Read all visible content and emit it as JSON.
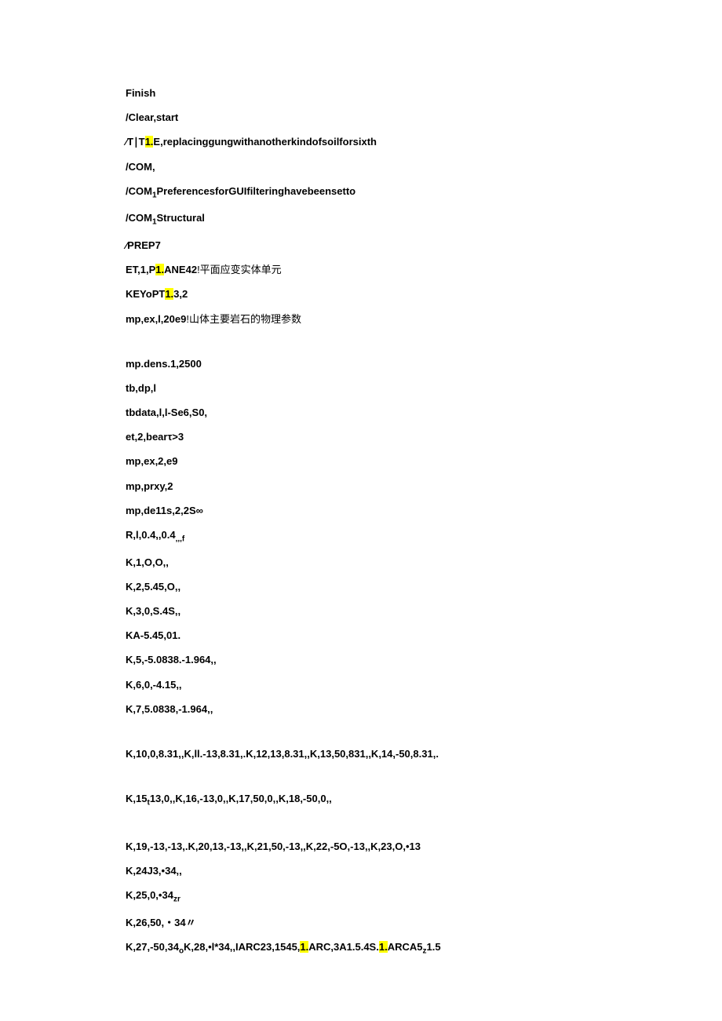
{
  "lines": {
    "l1": "Finish",
    "l2": "/Clear,start",
    "l3a": "∕T∣T",
    "l3b": "1.",
    "l3c": "E,replacinggungwithanotherkindofsoilforsixth",
    "l4": "/COM,",
    "l5a": "/COM",
    "l5b": "1",
    "l5c": "PreferencesforGUIfilteringhavebeensetto",
    "l6a": "/COM",
    "l6b": "1",
    "l6c": "Structural",
    "l7": "∕PREP7",
    "l8a": "ET,1,P",
    "l8b": "1.",
    "l8c": "ANE42",
    "l8d": "!平面应变实体单元",
    "l9a": "KEYoPT",
    "l9b": "1.",
    "l9c": "3,2",
    "l10a": "mp,ex,l,20e9",
    "l10b": "!山体主要岩石的物理参数",
    "l11": "mp.dens.1,2500",
    "l12": "tb,dp,l",
    "l13": "tbdata,l,l-Se6,S0,",
    "l14": "et,2,bearτ>3",
    "l15": "mp,ex,2,e9",
    "l16": "mp,prxy,2",
    "l17": "mp,de11s,2,2S∞",
    "l18a": "R,l,0.4,,0.4",
    "l18b": ",,,f",
    "l19": "K,1,O,O,,",
    "l20": "K,2,5.45,O,,",
    "l21": "K,3,0,S.4S,,",
    "l22": "KA-5.45,01.",
    "l23": "K,5,-5.0838.-1.964,,",
    "l24": "K,6,0,-4.15,,",
    "l25": "K,7,5.0838,-1.964,,",
    "l26": "K,10,0,8.31,,K,ll.-13,8.31,.K,12,13,8.31,,K,13,50,831,,K,14,-50,8.31,.",
    "l27a": "K,15",
    "l27b": "t",
    "l27c": "13,0,,K,16,-13,0,,K,17,50,0,,K,18,-50,0,,",
    "l28": "K,19,-13,-13,.K,20,13,-13,,K,21,50,-13,,K,22,-5O,-13,,K,23,O,•13",
    "l29": "K,24J3,•34,,",
    "l30a": "K,25,0,•34",
    "l30b": "zr",
    "l31": "K,26,50,・34〃",
    "l32a": "K,27,-50,34",
    "l32b": "o",
    "l32c": "K,28,•l*34,,IARC23,1545,",
    "l32d": "1.",
    "l32e": "ARC,3A1.5.4S.",
    "l32f": "1.",
    "l32g": "ARCA5",
    "l32h": "z",
    "l32i": "1.5"
  }
}
